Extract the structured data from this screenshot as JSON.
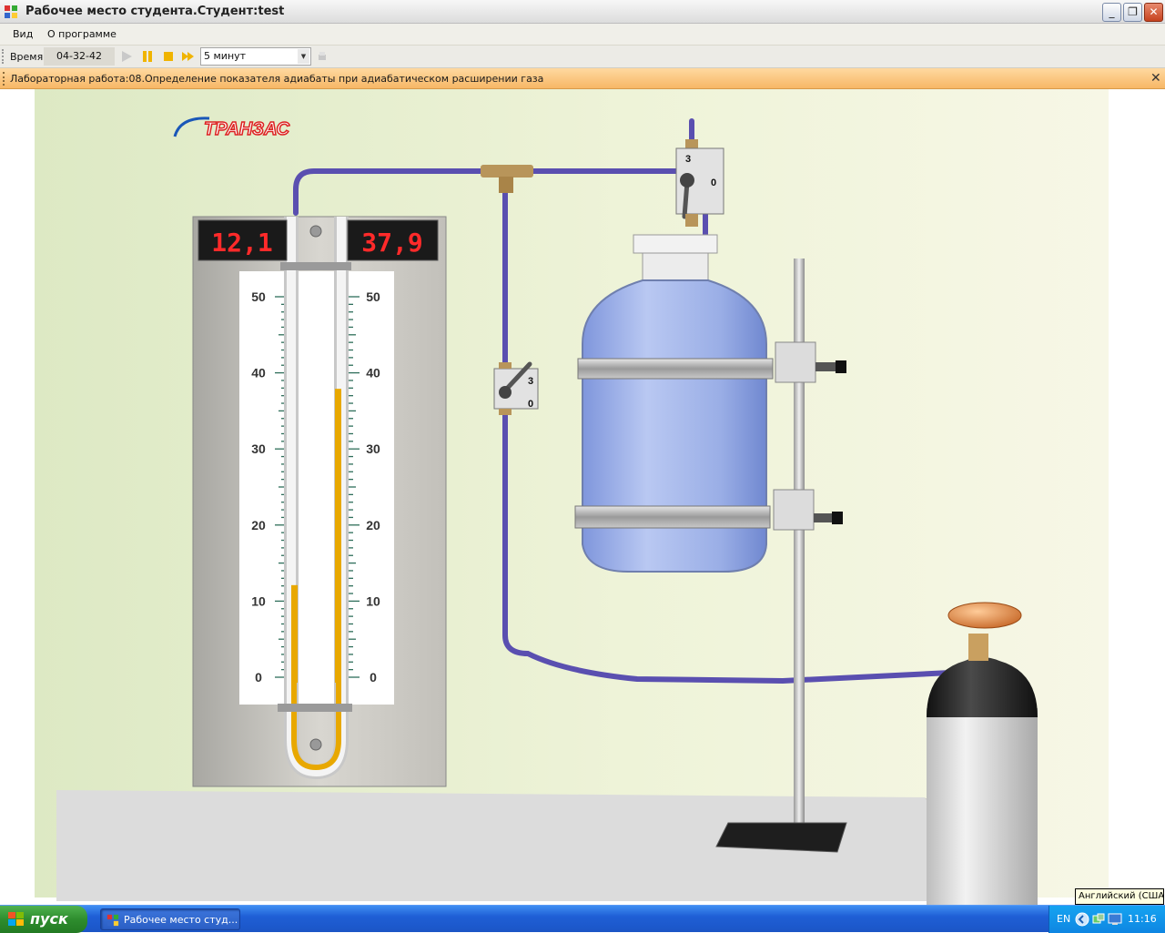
{
  "window": {
    "title": "Рабочее место студента.Студент:test"
  },
  "menu": {
    "items": [
      "Вид",
      "О программе"
    ]
  },
  "toolbar": {
    "time_label": "Время",
    "time_value": "04-32-42",
    "interval": "5 минут"
  },
  "infobar": {
    "text": "Лабораторная работа:08.Определение показателя адиабаты при адиабатическом расширении газа"
  },
  "scene": {
    "logo": "ТРАНЗАС",
    "display_left": "12,1",
    "display_right": "37,9",
    "scale_marks": [
      "50",
      "40",
      "30",
      "20",
      "10",
      "0"
    ],
    "manometer_left_level": 12.1,
    "manometer_right_level": 37.9,
    "valve_top": {
      "pos_a": "3",
      "pos_b": "0"
    },
    "valve_mid": {
      "pos_a": "3",
      "pos_b": "0"
    }
  },
  "taskbar": {
    "start": "пуск",
    "task": "Рабочее место студ...",
    "lang": "EN",
    "clock": "11:16"
  },
  "tooltip": "Английский (США)",
  "colors": {
    "infobar": "#f7b766",
    "fluid": "#e8a800",
    "display_digits": "#ff2a2a",
    "tubing": "#5a4fb0",
    "taskbar": "#1f5fd6"
  }
}
